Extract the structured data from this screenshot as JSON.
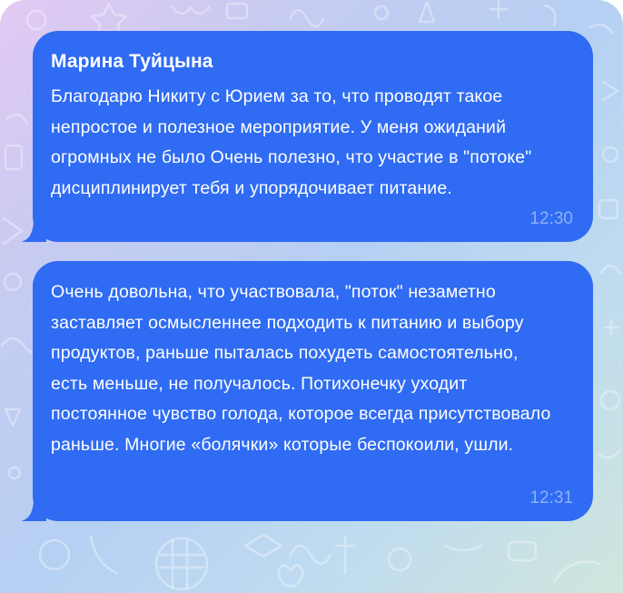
{
  "messages": [
    {
      "sender": "Марина Туйцына",
      "text": "Благодарю Никиту с Юрием за то, что проводят такое непростое и полезное мероприятие. У меня ожиданий огромных не было Очень полезно, что участие в \"потоке\" дисциплинирует тебя и упорядочивает питание.",
      "time": "12:30"
    },
    {
      "text": "Очень довольна, что участвовала, \"поток\" незаметно заставляет осмысленнее подходить к питанию и выбору продуктов, раньше пыталась похудеть самостоятельно, есть меньше, не получалось. Потихонечку уходит постоянное чувство голода, которое всегда присутствовало раньше. Многие «болячки» которые беспокоили, ушли.",
      "time": "12:31"
    }
  ],
  "colors": {
    "bubble": "#2f6bf3",
    "time": "#8fb0f8"
  }
}
